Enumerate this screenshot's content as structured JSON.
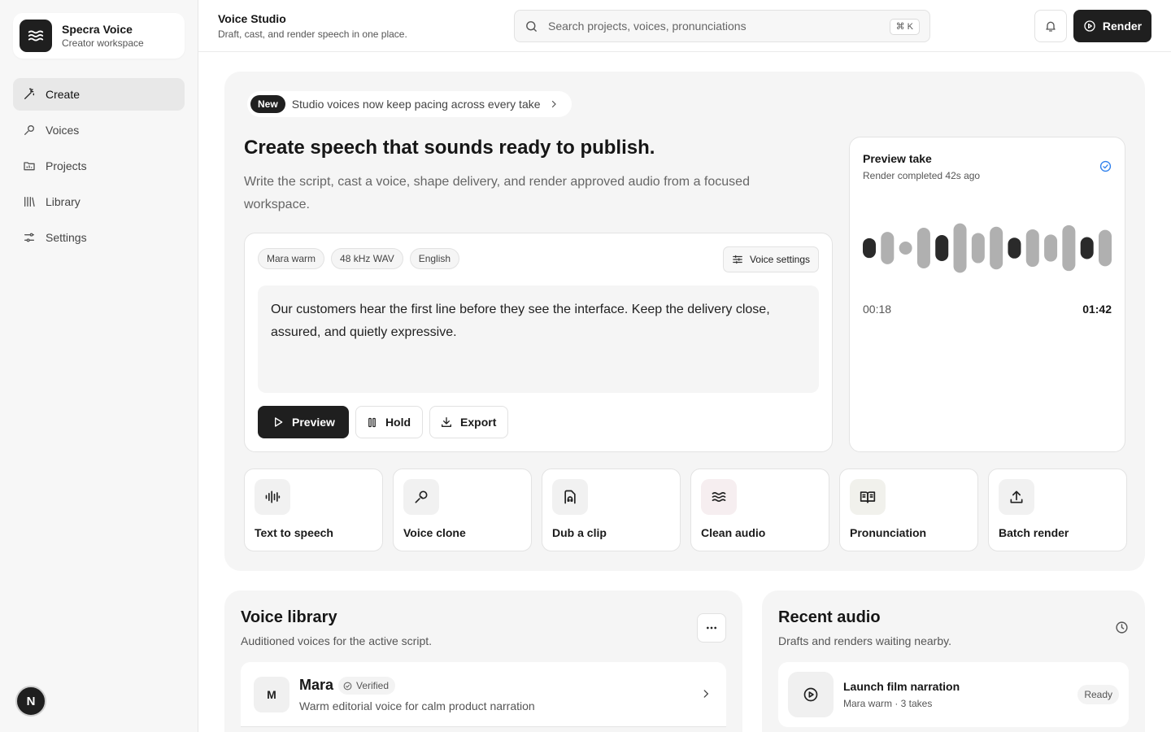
{
  "brand": {
    "name": "Specra Voice",
    "subtitle": "Creator workspace"
  },
  "nav": {
    "items": [
      {
        "label": "Create",
        "icon": "wand-icon",
        "active": true
      },
      {
        "label": "Voices",
        "icon": "mic-icon"
      },
      {
        "label": "Projects",
        "icon": "folder-icon"
      },
      {
        "label": "Library",
        "icon": "library-icon"
      },
      {
        "label": "Settings",
        "icon": "sliders-icon"
      }
    ],
    "avatar_letter": "N"
  },
  "header": {
    "title": "Voice Studio",
    "subtitle": "Draft, cast, and render speech in one place.",
    "search_placeholder": "Search projects, voices, pronunciations",
    "shortcut": "⌘ K",
    "render_label": "Render"
  },
  "hero": {
    "badge": "New",
    "announcement": "Studio voices now keep pacing across every take",
    "title": "Create speech that sounds ready to publish.",
    "description": "Write the script, cast a voice, shape delivery, and render approved audio from a focused workspace."
  },
  "editor": {
    "chips": [
      "Mara warm",
      "48 kHz WAV",
      "English"
    ],
    "voice_settings_label": "Voice settings",
    "script": "Our customers hear the first line before they see the interface. Keep the delivery close, assured, and quietly expressive.",
    "preview_label": "Preview",
    "hold_label": "Hold",
    "export_label": "Export"
  },
  "preview_take": {
    "title": "Preview take",
    "status": "Render completed 42s ago",
    "elapsed": "00:18",
    "duration": "01:42",
    "waveform_levels": [
      0.38,
      0.62,
      0.25,
      0.78,
      0.5,
      0.95,
      0.58,
      0.82,
      0.4,
      0.72,
      0.52,
      0.88,
      0.42,
      0.7
    ],
    "waveform_active": [
      true,
      false,
      false,
      false,
      true,
      false,
      false,
      false,
      true,
      false,
      false,
      false,
      true,
      false
    ],
    "colors": {
      "active": "#2a2a2a",
      "inactive": "#b0b0b0"
    }
  },
  "tools": [
    {
      "label": "Text to speech",
      "icon": "waveform-icon",
      "tint": "#f1f1f1"
    },
    {
      "label": "Voice clone",
      "icon": "mic-icon",
      "tint": "#f1f1f1"
    },
    {
      "label": "Dub a clip",
      "icon": "dub-icon",
      "tint": "#f1f1f1"
    },
    {
      "label": "Clean audio",
      "icon": "waves-icon",
      "tint": "#f6eef0"
    },
    {
      "label": "Pronunciation",
      "icon": "book-icon",
      "tint": "#f1f1ec"
    },
    {
      "label": "Batch render",
      "icon": "upload-icon",
      "tint": "#f1f1f1"
    }
  ],
  "voice_library": {
    "title": "Voice library",
    "subtitle": "Auditioned voices for the active script.",
    "voices": [
      {
        "initial": "M",
        "name": "Mara",
        "badge": "Verified",
        "description": "Warm editorial voice for calm product narration"
      }
    ]
  },
  "recent_audio": {
    "title": "Recent audio",
    "subtitle": "Drafts and renders waiting nearby.",
    "items": [
      {
        "title": "Launch film narration",
        "meta": "Mara warm · 3 takes",
        "status": "Ready"
      }
    ]
  }
}
